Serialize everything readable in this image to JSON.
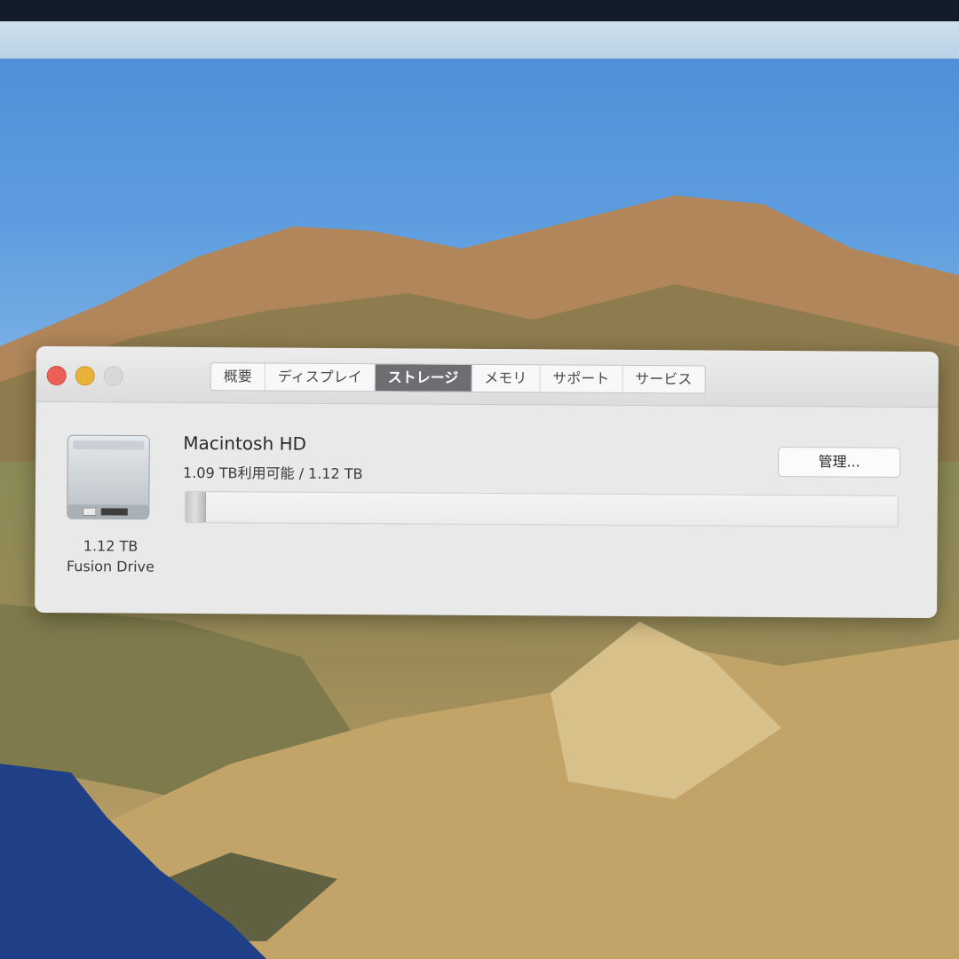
{
  "window": {
    "tabs": [
      {
        "label": "概要"
      },
      {
        "label": "ディスプレイ"
      },
      {
        "label": "ストレージ"
      },
      {
        "label": "メモリ"
      },
      {
        "label": "サポート"
      },
      {
        "label": "サービス"
      }
    ],
    "active_tab": "ストレージ"
  },
  "disk": {
    "size": "1.12 TB",
    "type": "Fusion Drive",
    "icon": "hard-drive-icon"
  },
  "volume": {
    "name": "Macintosh HD",
    "availability": "1.09 TB利用可能 / 1.12 TB",
    "used_fraction": 0.027
  },
  "manage_button": {
    "label": "管理..."
  },
  "colors": {
    "active_tab": "#6d6d72",
    "close": "#ec5f57",
    "minimize": "#e8b338"
  }
}
